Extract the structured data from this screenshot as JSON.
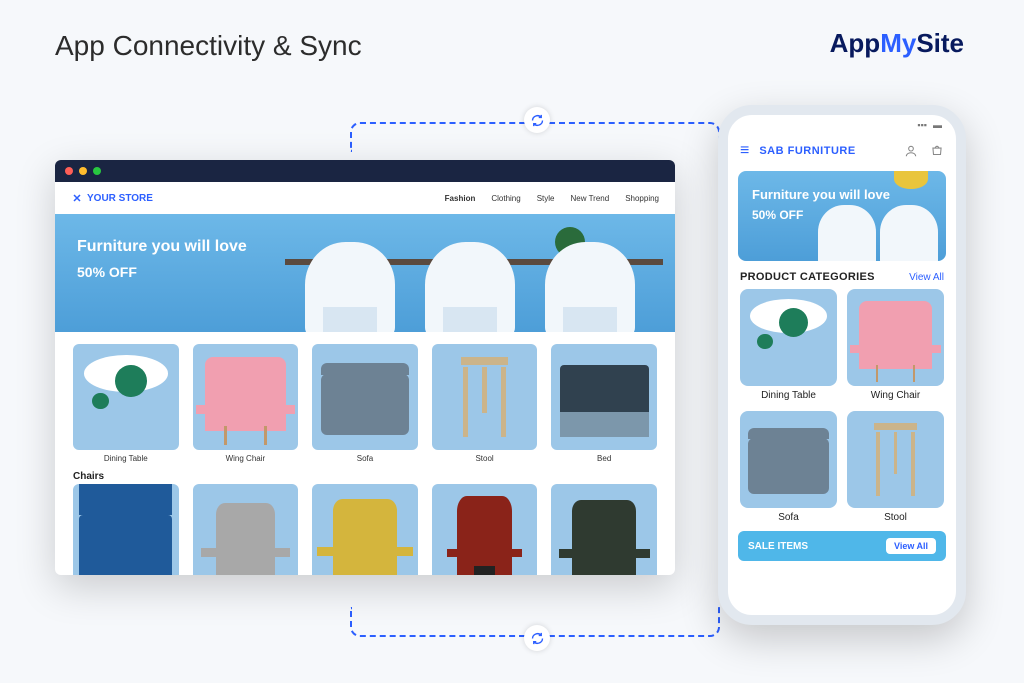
{
  "page": {
    "title": "App Connectivity & Sync"
  },
  "brand": {
    "part1": "App",
    "part2": "My",
    "part3": "Site"
  },
  "website": {
    "store_name": "YOUR STORE",
    "nav": {
      "n0": "Fashion",
      "n1": "Clothing",
      "n2": "Style",
      "n3": "New Trend",
      "n4": "Shopping"
    },
    "hero": {
      "headline": "Furniture you will love",
      "promo": "50% OFF"
    },
    "categories": {
      "c0": "Dining Table",
      "c1": "Wing Chair",
      "c2": "Sofa",
      "c3": "Stool",
      "c4": "Bed"
    },
    "section2": "Chairs"
  },
  "app": {
    "title": "SAB FURNITURE",
    "hero": {
      "headline": "Furniture you will love",
      "promo": "50% OFF"
    },
    "cat_title": "PRODUCT CATEGORIES",
    "view_all": "View All",
    "categories": {
      "c0": "Dining Table",
      "c1": "Wing Chair",
      "c2": "Sofa",
      "c3": "Stool"
    },
    "sale_title": "SALE ITEMS",
    "sale_btn": "View All"
  }
}
